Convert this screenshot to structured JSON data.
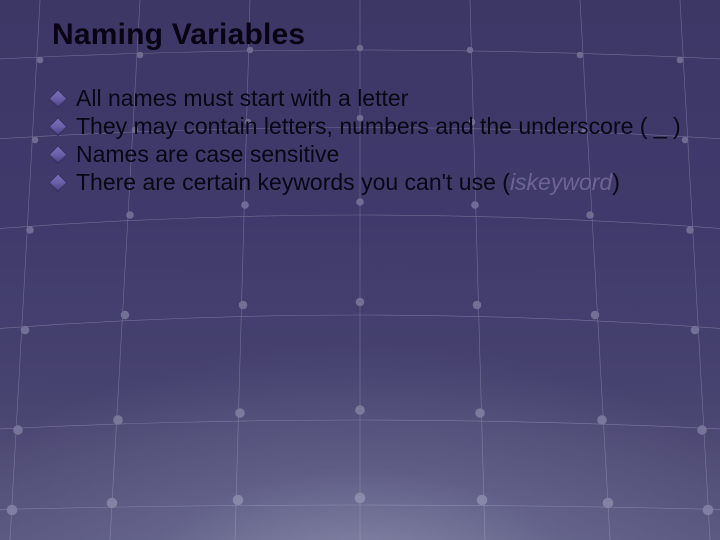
{
  "slide": {
    "title": "Naming Variables",
    "bullets": [
      {
        "text": "All names must start with a letter"
      },
      {
        "text": "They may contain letters, numbers and the underscore ( _ )"
      },
      {
        "text": "Names are case sensitive"
      },
      {
        "text_prefix": "There are certain keywords you can't use (",
        "keyword": "iskeyword",
        "text_suffix": ")"
      }
    ]
  }
}
